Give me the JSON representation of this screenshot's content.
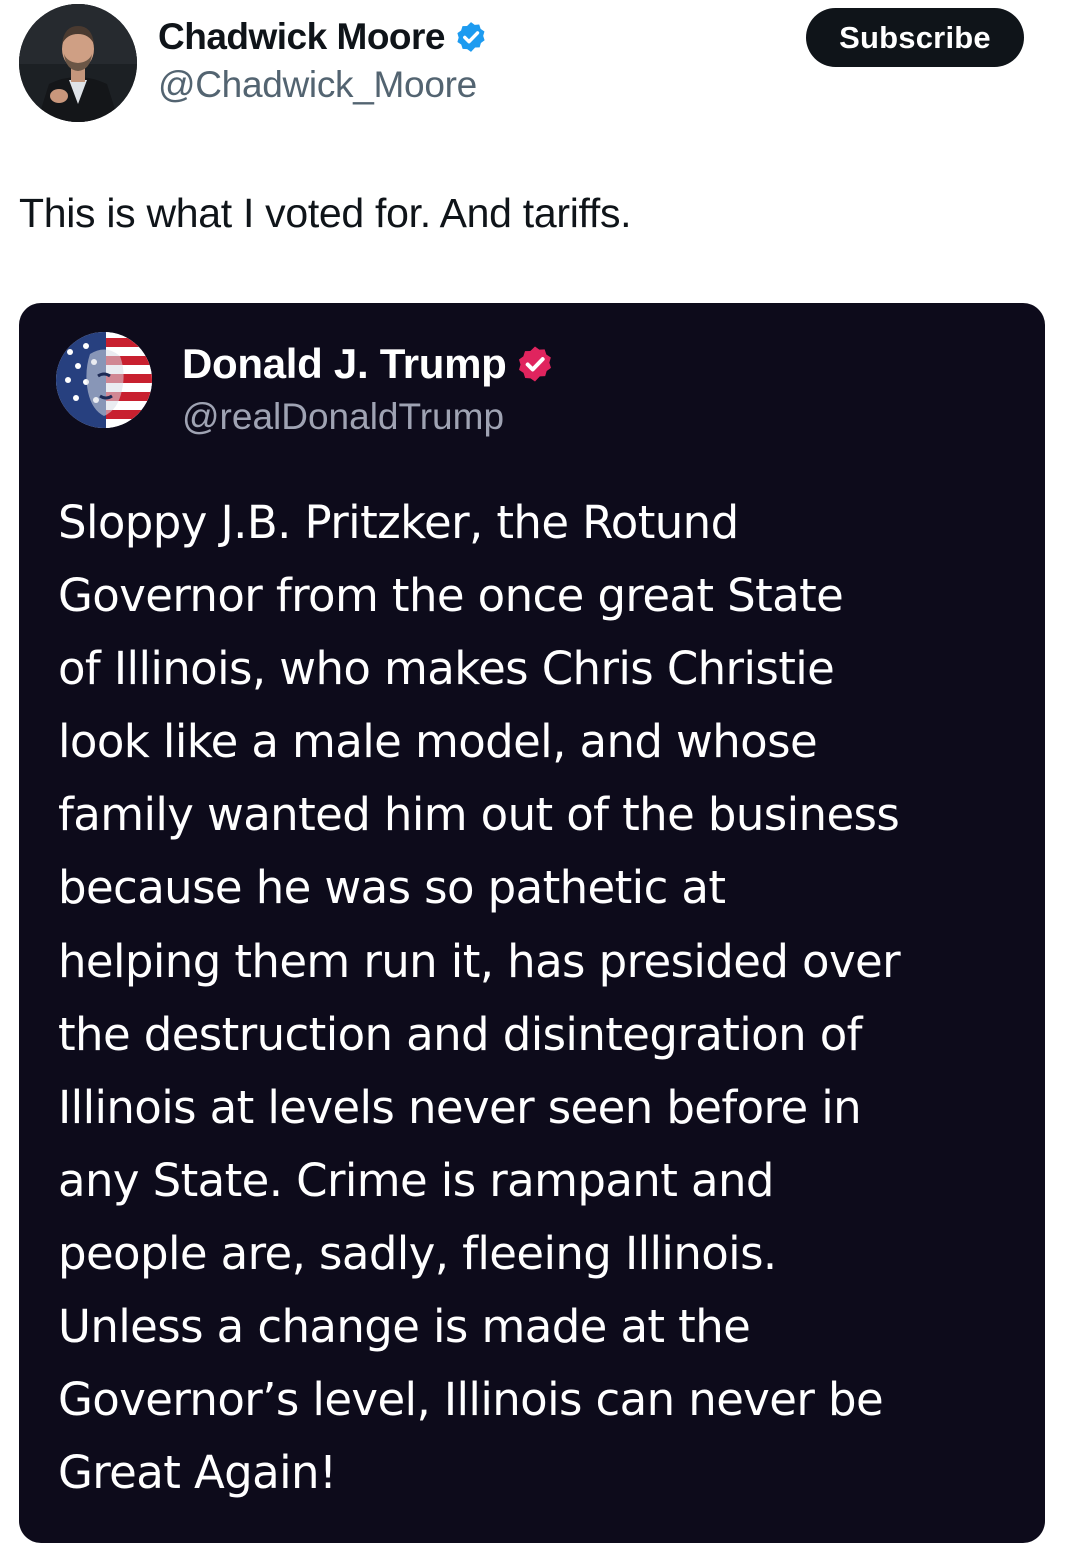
{
  "post": {
    "author": {
      "name": "Chadwick Moore",
      "handle": "@Chadwick_Moore",
      "verified_color": "#1d9bf0"
    },
    "subscribe_label": "Subscribe",
    "text": "This is what I voted for. And tariffs."
  },
  "quoted_post": {
    "author": {
      "name": "Donald J. Trump",
      "handle": "@realDonaldTrump",
      "verified_color": "#e0245e"
    },
    "background_color": "#0d0b1b",
    "body_lines": [
      "Sloppy J.B. Pritzker, the Rotund",
      "Governor from the once great State",
      "of Illinois, who makes Chris Christie",
      "look like a male model, and whose",
      "family wanted him out of the business",
      "because he was so pathetic at",
      "helping them run it, has presided over",
      "the destruction and disintegration of",
      "Illinois at levels never seen before in",
      "any State. Crime is rampant and",
      "people are, sadly, fleeing Illinois.",
      "Unless a change is made at the",
      "Governor’s level, Illinois can never be",
      "Great Again!"
    ]
  },
  "icons": [
    "verified-badge-icon",
    "verified-badge-icon"
  ]
}
